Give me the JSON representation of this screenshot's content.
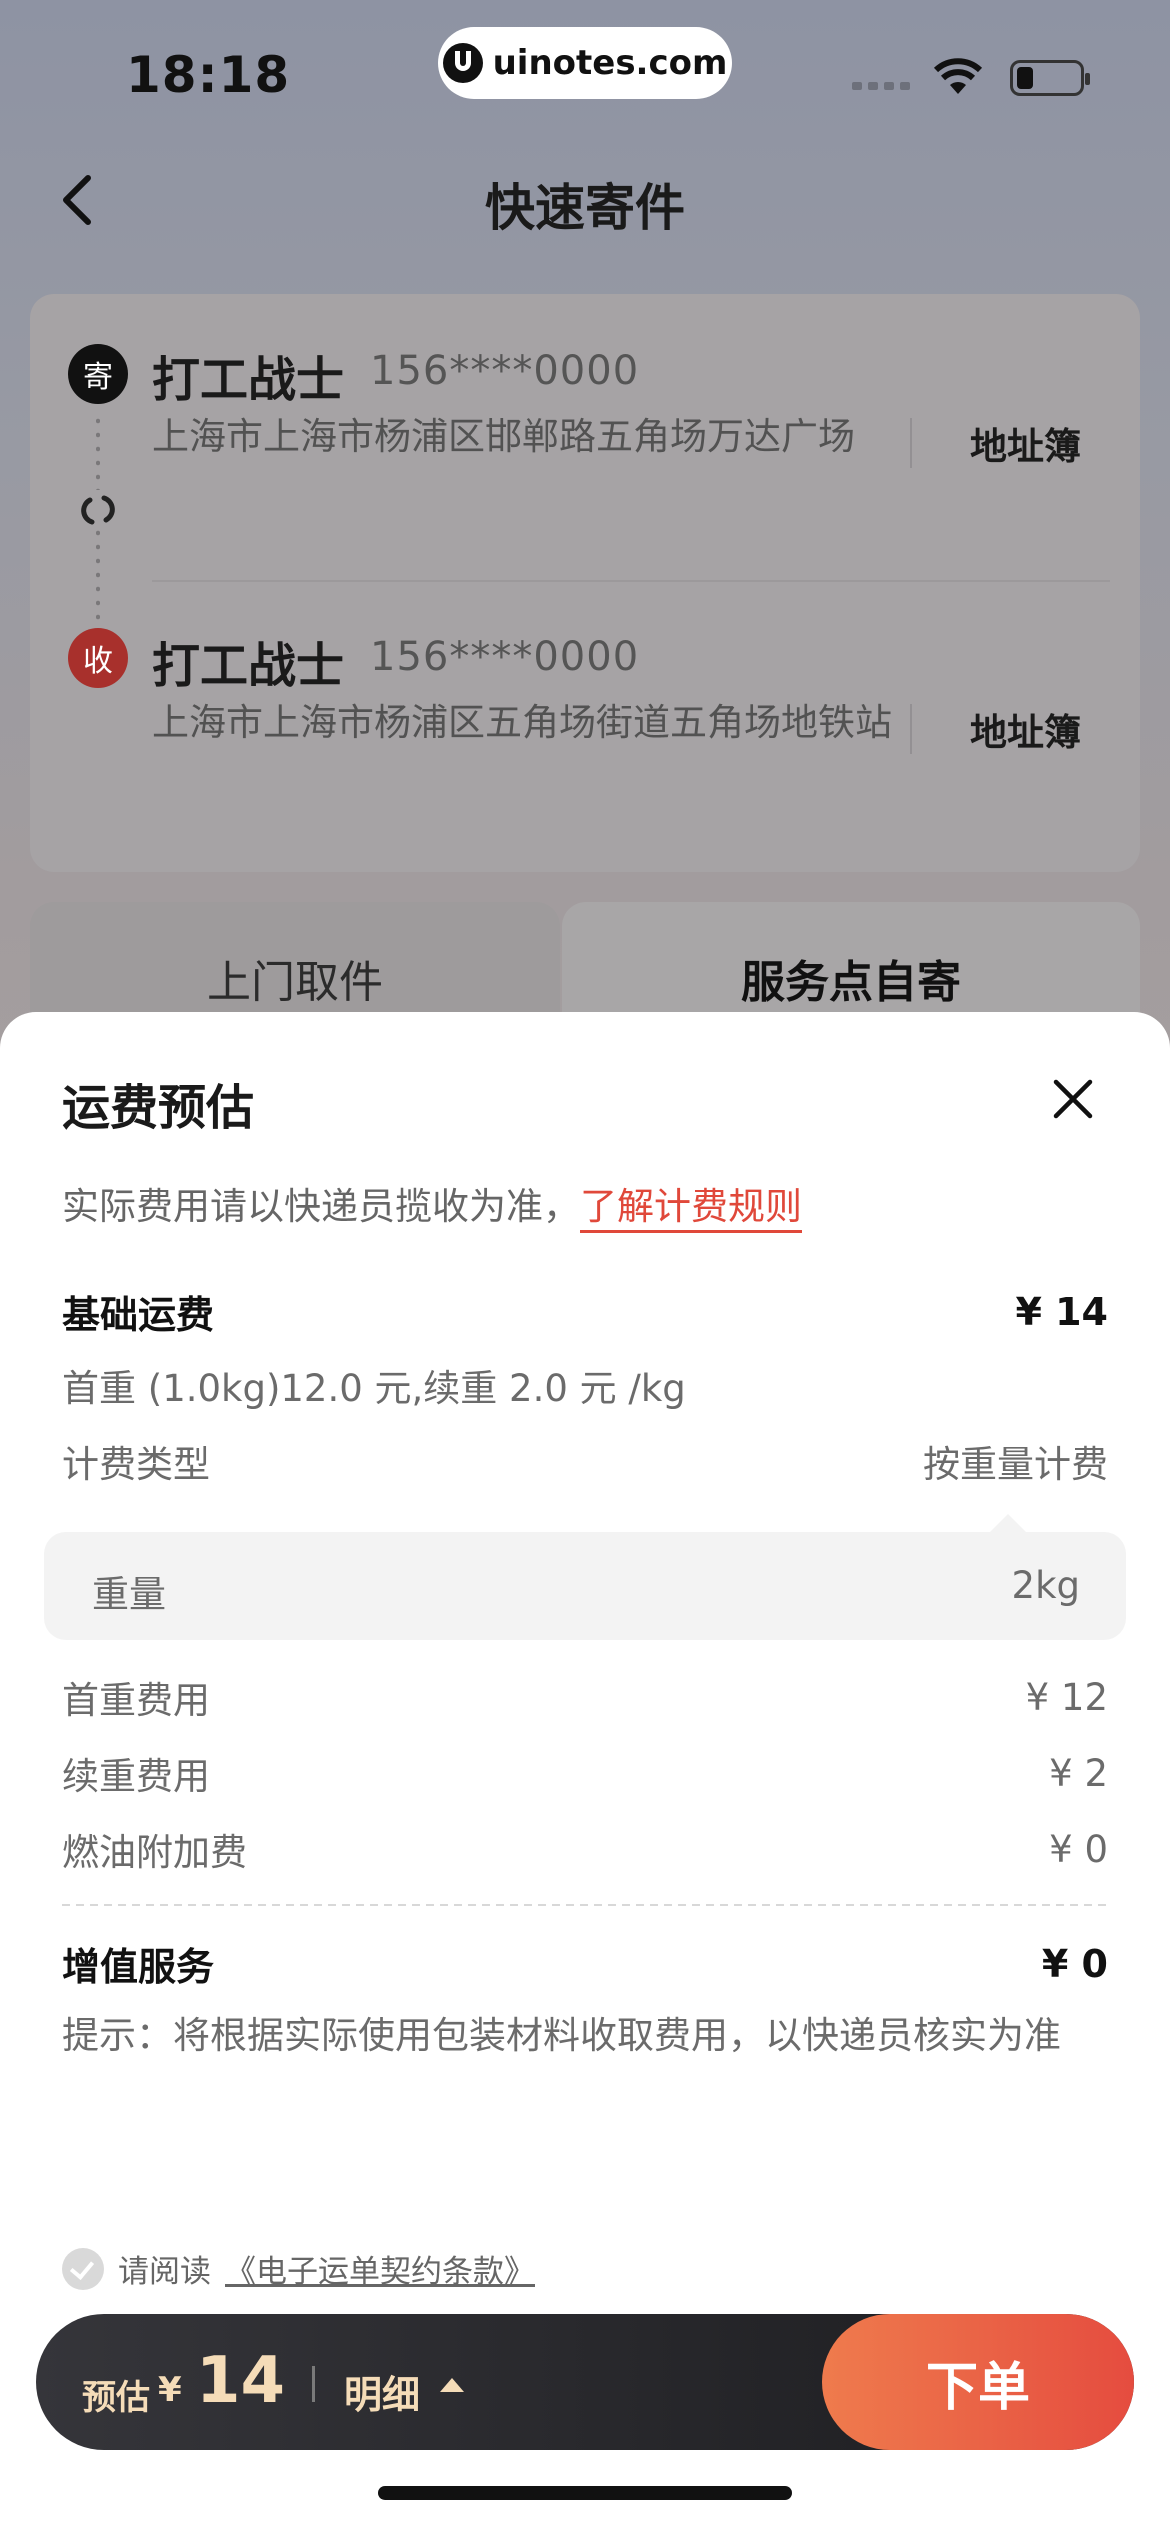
{
  "status": {
    "time": "18:18",
    "watermark": "uinotes.com"
  },
  "nav": {
    "title": "快速寄件"
  },
  "sender": {
    "badge": "寄",
    "name": "打工战士",
    "phone": "156****0000",
    "address": "上海市上海市杨浦区邯郸路五角场万达广场",
    "book": "地址簿"
  },
  "receiver": {
    "badge": "收",
    "name": "打工战士",
    "phone": "156****0000",
    "address": "上海市上海市杨浦区五角场街道五角场地铁站",
    "book": "地址簿"
  },
  "tabs": [
    {
      "label": "上门取件",
      "active": false
    },
    {
      "label": "服务点自寄",
      "active": true
    }
  ],
  "sheet": {
    "title": "运费预估",
    "notice_prefix": "实际费用请以快递员揽收为准，",
    "notice_link": "了解计费规则",
    "base_fee": {
      "label": "基础运费",
      "value": "¥ 14"
    },
    "rate_desc": "首重 (1.0kg)12.0 元,续重 2.0 元 /kg",
    "billing_type": {
      "label": "计费类型",
      "value": "按重量计费"
    },
    "weight": {
      "label": "重量",
      "value": "2kg"
    },
    "first_weight_fee": {
      "label": "首重费用",
      "value": "¥ 12"
    },
    "extra_weight_fee": {
      "label": "续重费用",
      "value": "¥ 2"
    },
    "fuel_fee": {
      "label": "燃油附加费",
      "value": "¥ 0"
    },
    "value_added": {
      "label": "增值服务",
      "value": "¥ 0"
    },
    "hint": "提示：将根据实际使用包装材料收取费用，以快递员核实为准"
  },
  "agreement": {
    "prefix": "请阅读",
    "link": "《电子运单契约条款》"
  },
  "order_bar": {
    "est_label": "预估",
    "currency": "¥",
    "amount": "14",
    "detail_label": "明细",
    "submit_label": "下单"
  },
  "colors": {
    "accent": "#e54c3f",
    "gold": "#f5dcb8",
    "link": "#e0483a"
  }
}
